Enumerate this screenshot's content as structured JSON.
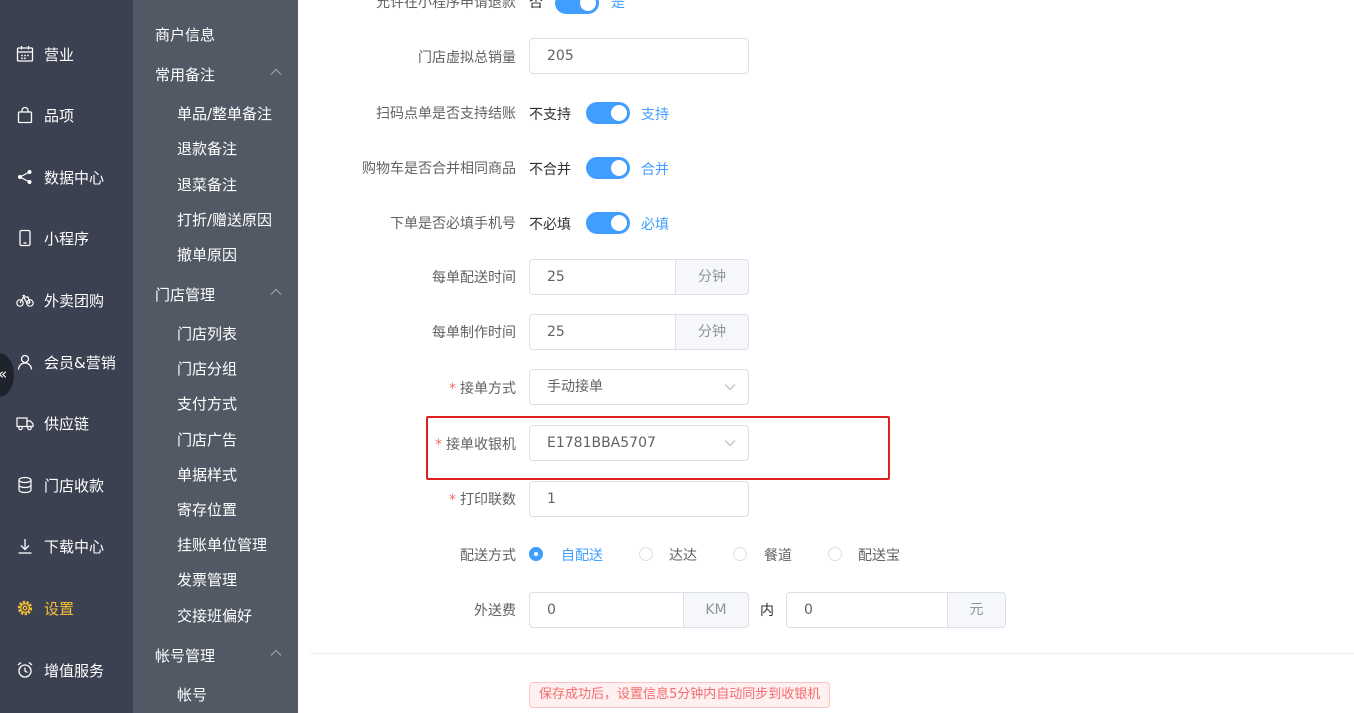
{
  "main_nav": [
    {
      "label": "营业",
      "icon": "calendar-icon"
    },
    {
      "label": "品项",
      "icon": "shopping-bag-icon"
    },
    {
      "label": "数据中心",
      "icon": "share-icon"
    },
    {
      "label": "小程序",
      "icon": "mobile-icon"
    },
    {
      "label": "外卖团购",
      "icon": "bicycle-icon"
    },
    {
      "label": "会员&营销",
      "icon": "user-icon"
    },
    {
      "label": "供应链",
      "icon": "truck-icon"
    },
    {
      "label": "门店收款",
      "icon": "database-icon"
    },
    {
      "label": "下载中心",
      "icon": "download-icon"
    },
    {
      "label": "设置",
      "icon": "gear-icon",
      "active": true
    },
    {
      "label": "增值服务",
      "icon": "alarm-clock-icon"
    }
  ],
  "collapse_glyph": "«",
  "sub_nav": {
    "merchant_info": "商户信息",
    "remarks": {
      "title": "常用备注",
      "items": [
        "单品/整单备注",
        "退款备注",
        "退菜备注",
        "打折/赠送原因",
        "撤单原因"
      ]
    },
    "store": {
      "title": "门店管理",
      "items": [
        "门店列表",
        "门店分组",
        "支付方式",
        "门店广告",
        "单据样式",
        "寄存位置",
        "挂账单位管理",
        "发票管理",
        "交接班偏好"
      ]
    },
    "account": {
      "title": "帐号管理",
      "items": [
        "帐号"
      ]
    }
  },
  "form": {
    "refund": {
      "label": "允许在小程序申请退款",
      "off": "否",
      "on": "是"
    },
    "virtual_sales": {
      "label": "门店虚拟总销量",
      "value": "205"
    },
    "scan_checkout": {
      "label": "扫码点单是否支持结账",
      "off": "不支持",
      "on": "支持"
    },
    "cart_merge": {
      "label": "购物车是否合并相同商品",
      "off": "不合并",
      "on": "合并"
    },
    "phone_required": {
      "label": "下单是否必填手机号",
      "off": "不必填",
      "on": "必填"
    },
    "delivery_time": {
      "label": "每单配送时间",
      "value": "25",
      "unit": "分钟"
    },
    "prep_time": {
      "label": "每单制作时间",
      "value": "25",
      "unit": "分钟"
    },
    "accept_mode": {
      "label": "接单方式",
      "value": "手动接单",
      "required_mark": "*"
    },
    "cashier": {
      "label": "接单收银机",
      "value": "E1781BBA5707",
      "required_mark": "*"
    },
    "print_copies": {
      "label": "打印联数",
      "value": "1",
      "required_mark": "*"
    },
    "delivery_method": {
      "label": "配送方式",
      "options": [
        "自配送",
        "达达",
        "餐道",
        "配送宝"
      ],
      "selected": "自配送"
    },
    "delivery_fee": {
      "label": "外送费",
      "distance": "0",
      "distance_unit": "KM",
      "within": "内",
      "fee": "0",
      "fee_unit": "元"
    }
  },
  "notice": "保存成功后，设置信息5分钟内自动同步到收银机",
  "colors": {
    "primary": "#409eff",
    "sidebar_dark": "#3b4150",
    "sidebar_sub": "#515965",
    "active_nav": "#f5c038",
    "highlight": "#e02020",
    "danger": "#f56c6c"
  }
}
